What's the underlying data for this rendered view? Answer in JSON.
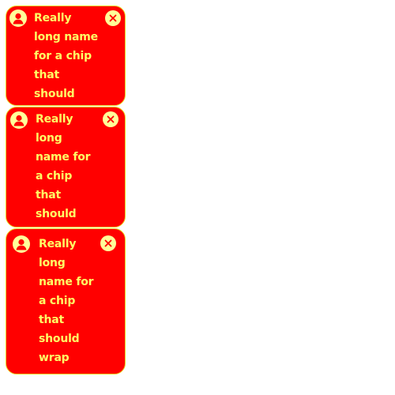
{
  "colors": {
    "chip_background": "#ff0000",
    "chip_text": "#ffff66",
    "chip_border": "#e8d820",
    "icon_background": "#ffff99",
    "icon_foreground": "#ff0000"
  },
  "chips": [
    {
      "label": "Really long name for a chip that should wrap",
      "avatar_icon": "person-icon",
      "remove_icon": "close-icon"
    },
    {
      "label": "Really long name for a chip that should wrap",
      "avatar_icon": "person-icon",
      "remove_icon": "close-icon"
    },
    {
      "label": "Really long name for a chip that should wrap",
      "avatar_icon": "person-icon",
      "remove_icon": "close-icon"
    }
  ]
}
